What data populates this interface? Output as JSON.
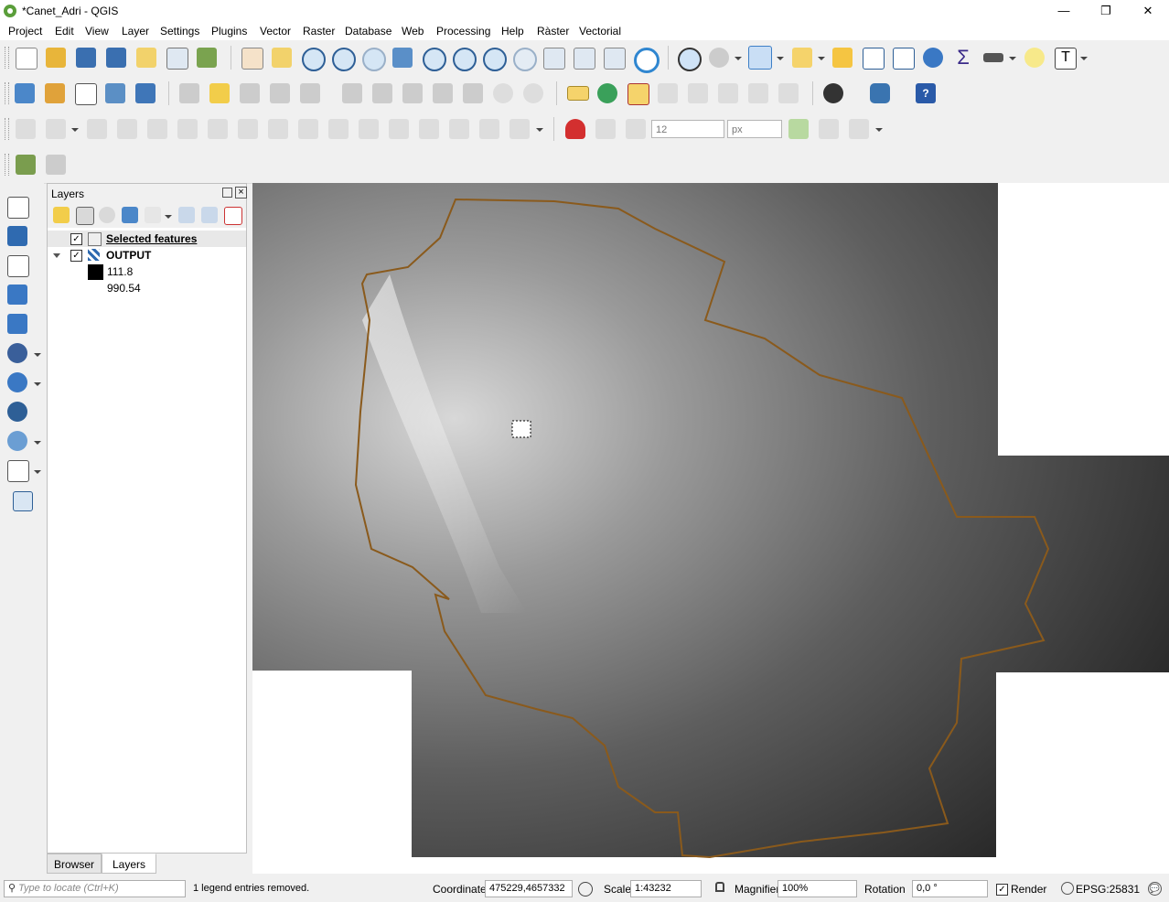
{
  "window": {
    "title": "*Canet_Adri - QGIS",
    "minimize": "—",
    "restore": "❐",
    "close": "✕"
  },
  "menu": [
    "Project",
    "Edit",
    "View",
    "Layer",
    "Settings",
    "Plugins",
    "Vector",
    "Raster",
    "Database",
    "Web",
    "Processing",
    "Help",
    "Ràster",
    "Vectorial"
  ],
  "digitizing": {
    "tolerance_value": "12",
    "tolerance_unit": "px"
  },
  "layers_panel": {
    "title": "Layers",
    "items": [
      {
        "label": "Selected features",
        "checked": true
      },
      {
        "label": "OUTPUT",
        "checked": true,
        "expanded": true
      }
    ],
    "legend": [
      {
        "label": "111.8",
        "color": "#000000"
      },
      {
        "label": "990.54",
        "color": "#ffffff"
      }
    ]
  },
  "tabs": {
    "browser": "Browser",
    "layers": "Layers"
  },
  "statusbar": {
    "locate_placeholder": "Type to locate (Ctrl+K)",
    "message": "1 legend entries removed.",
    "coordinate_label": "Coordinate",
    "coordinate_value": "475229,4657332",
    "scale_label": "Scale",
    "scale_value": "1:43232",
    "magnifier_label": "Magnifier",
    "magnifier_value": "100%",
    "rotation_label": "Rotation",
    "rotation_value": "0,0 °",
    "render_label": "Render",
    "crs": "EPSG:25831"
  },
  "colors": {
    "boundary": "#8a5a1c",
    "accent_select": "#f5c542"
  }
}
